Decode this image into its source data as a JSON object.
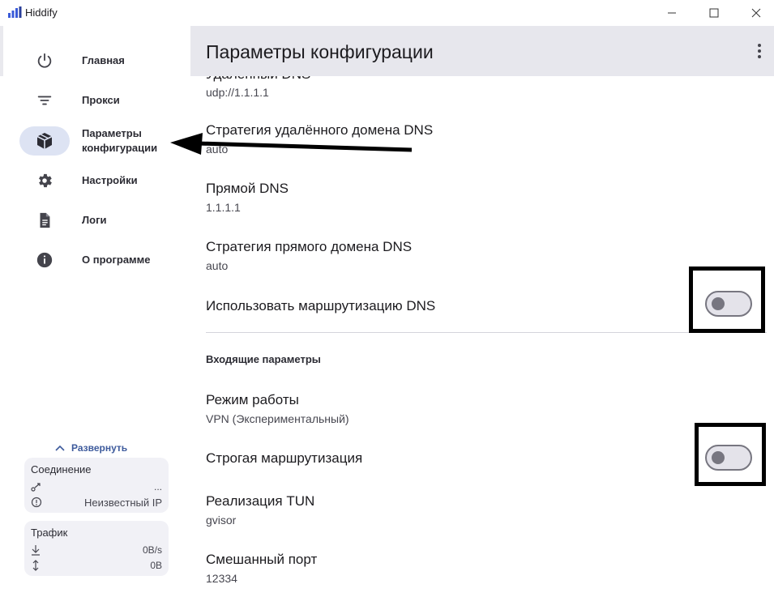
{
  "app": {
    "title": "Hiddify"
  },
  "sidebar": {
    "items": [
      {
        "label": "Главная",
        "icon": "power-icon",
        "active": false
      },
      {
        "label": "Прокси",
        "icon": "filter-icon",
        "active": false
      },
      {
        "label": "Параметры конфигурации",
        "icon": "box-icon",
        "active": true
      },
      {
        "label": "Настройки",
        "icon": "gear-icon",
        "active": false
      },
      {
        "label": "Логи",
        "icon": "document-icon",
        "active": false
      },
      {
        "label": "О программе",
        "icon": "info-icon",
        "active": false
      }
    ],
    "expand_label": "Развернуть",
    "connection_card": {
      "title": "Соединение",
      "ping_value": "...",
      "ip_label": "Неизвестный IP"
    },
    "traffic_card": {
      "title": "Трафик",
      "speed": "0B/s",
      "total": "0B"
    }
  },
  "header": {
    "title": "Параметры конфигурации"
  },
  "settings": {
    "partial_above_title": "Удалённый DNS",
    "remote_dns_value": "udp://1.1.1.1",
    "items": [
      {
        "title": "Стратегия удалённого домена DNS",
        "value": "auto"
      },
      {
        "title": "Прямой DNS",
        "value": "1.1.1.1"
      },
      {
        "title": "Стратегия прямого домена DNS",
        "value": "auto"
      }
    ],
    "dns_routing": {
      "title": "Использовать маршрутизацию DNS",
      "enabled": false
    },
    "inbound_section_title": "Входящие параметры",
    "service_mode": {
      "title": "Режим работы",
      "value": "VPN (Экспериментальный)"
    },
    "strict_route": {
      "title": "Строгая маршрутизация",
      "enabled": false
    },
    "tun_impl": {
      "title": "Реализация TUN",
      "value": "gvisor"
    },
    "mixed_port": {
      "title": "Смешанный порт",
      "value": "12334"
    }
  },
  "colors": {
    "accent": "#3d5a9c",
    "active_nav_bg": "#dde3f3",
    "header_bg": "#e7e7ed",
    "highlight_box": "#000000",
    "logo_blue": "#3a5bd9"
  }
}
